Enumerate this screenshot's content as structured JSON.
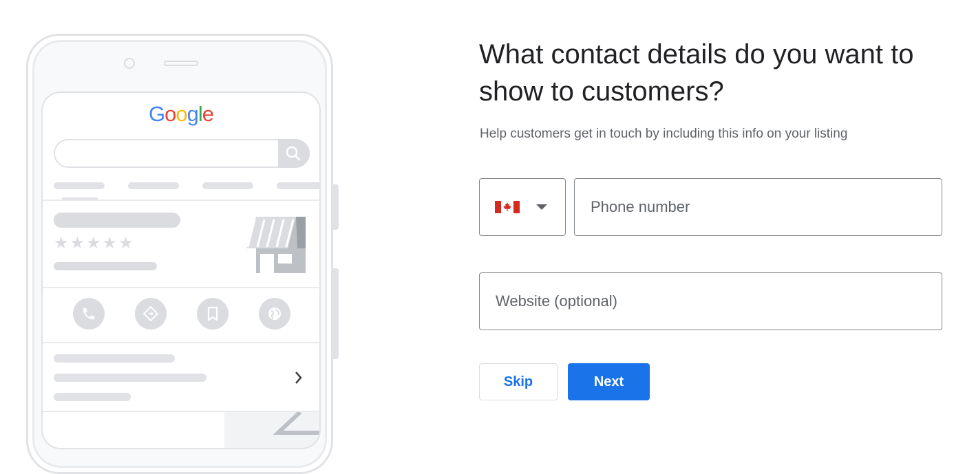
{
  "illustration": {
    "brand_letters": [
      {
        "char": "G",
        "color": "#4285F4"
      },
      {
        "char": "o",
        "color": "#EA4335"
      },
      {
        "char": "o",
        "color": "#FBBC05"
      },
      {
        "char": "g",
        "color": "#4285F4"
      },
      {
        "char": "l",
        "color": "#34A853"
      },
      {
        "char": "e",
        "color": "#EA4335"
      }
    ],
    "rating_stars": "★★★★★",
    "action_icons": [
      "phone-icon",
      "directions-icon",
      "bookmark-icon",
      "globe-icon"
    ],
    "placeholder_color": "#dadce0"
  },
  "form": {
    "title": "What contact details do you want to show to customers?",
    "subtitle": "Help customers get in touch by including this info on your listing",
    "country": {
      "selected": "Canada",
      "flag_icon": "canada-flag-icon"
    },
    "phone": {
      "placeholder": "Phone number",
      "value": ""
    },
    "website": {
      "placeholder": "Website (optional)",
      "value": ""
    },
    "skip_label": "Skip",
    "next_label": "Next",
    "accent_color": "#1a73e8"
  }
}
